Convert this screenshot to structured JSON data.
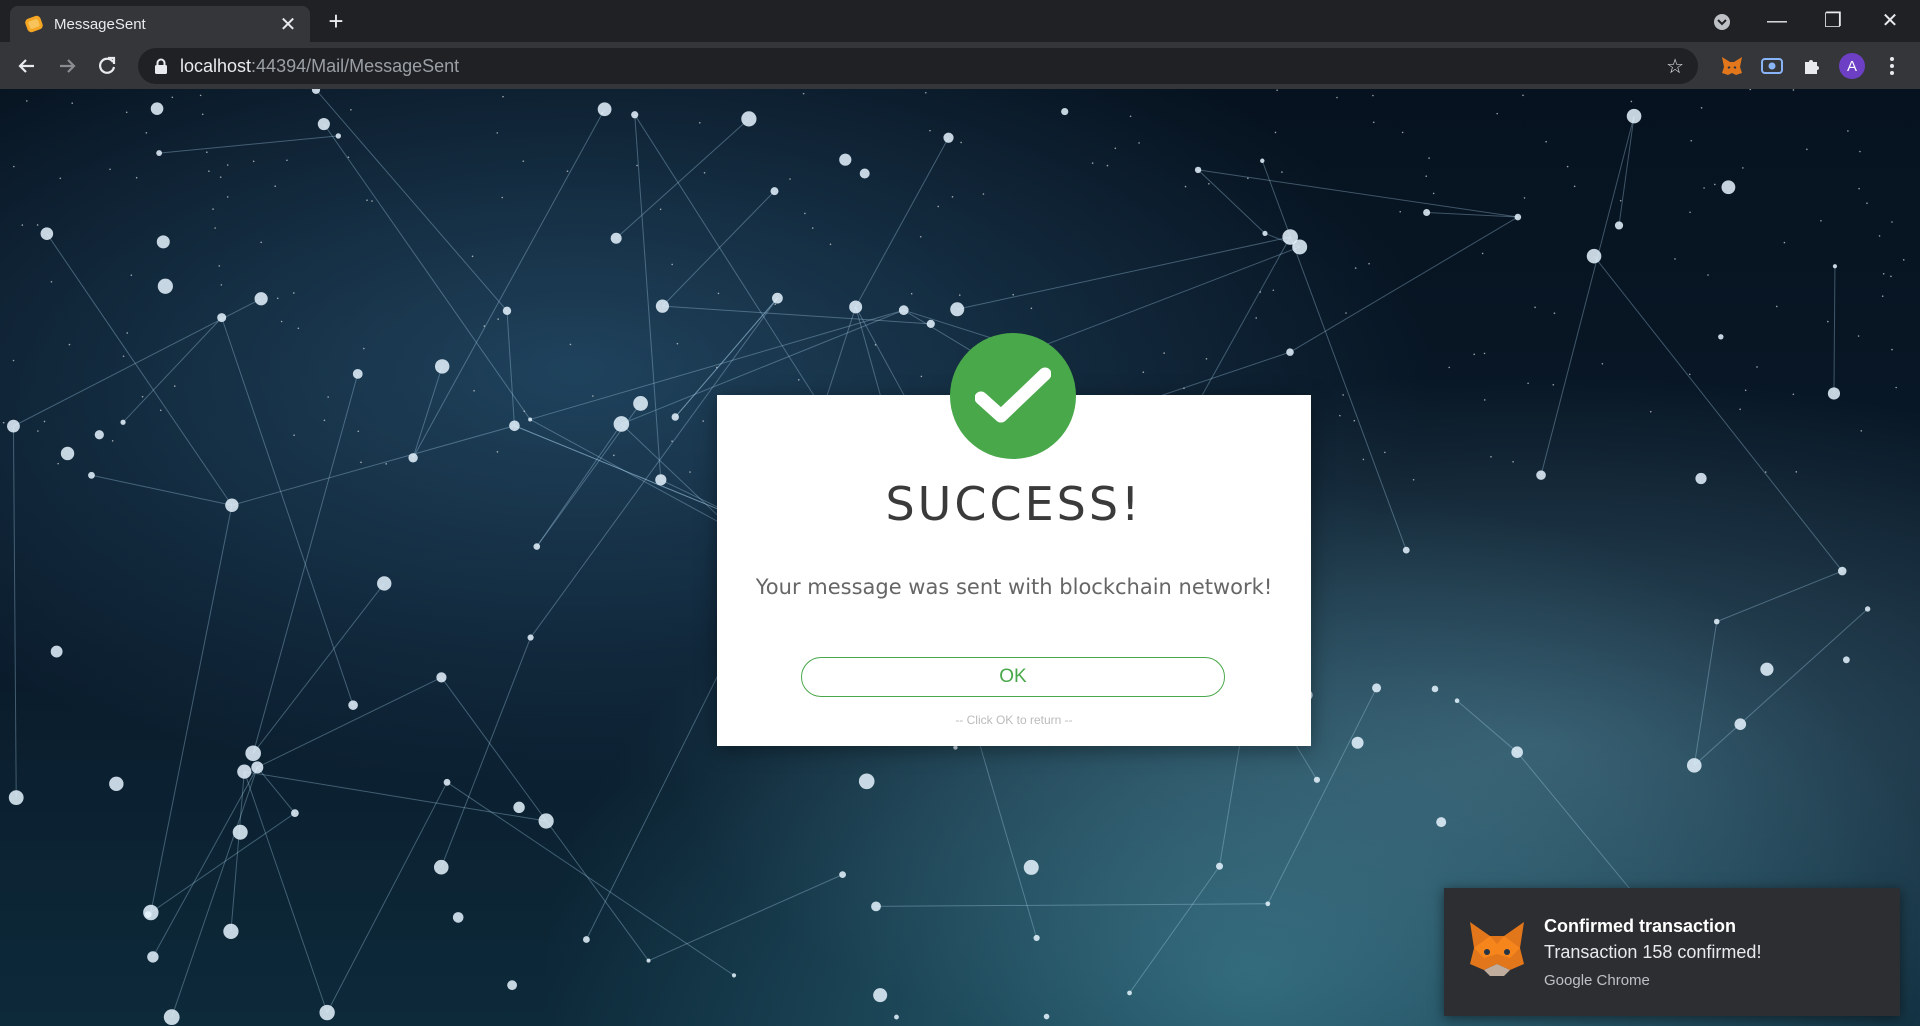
{
  "browser": {
    "tab_title": "MessageSent",
    "tab_close": "✕",
    "new_tab": "+",
    "url_host": "localhost",
    "url_path": ":44394/Mail/MessageSent",
    "profile_initial": "A",
    "window_controls": {
      "minimize": "—",
      "restore": "❐",
      "close": "✕"
    },
    "icons": [
      "back-icon",
      "forward-icon",
      "reload-icon",
      "lock-icon",
      "star-icon",
      "metamask-extension-icon",
      "screen-capture-extension-icon",
      "extensions-puzzle-icon",
      "menu-kebab-icon"
    ]
  },
  "modal": {
    "title": "SUCCESS!",
    "message": "Your message was sent with blockchain network!",
    "ok_label": "OK",
    "hint": "-- Click OK to return --",
    "accent_color": "#49a84a"
  },
  "notification": {
    "title": "Confirmed transaction",
    "body": "Transaction 158 confirmed!",
    "source": "Google Chrome"
  }
}
